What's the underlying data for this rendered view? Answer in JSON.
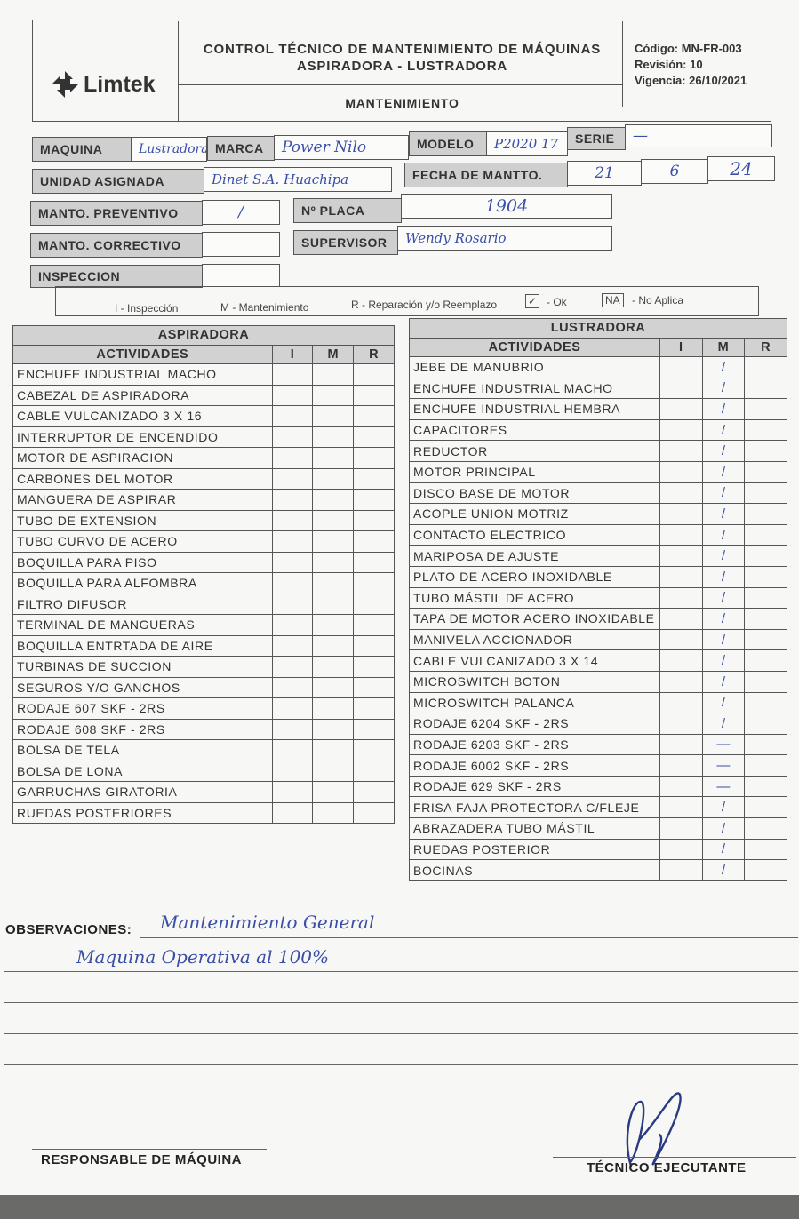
{
  "header": {
    "logo_text": "Limtek",
    "title_line1": "CONTROL TÉCNICO DE MANTENIMIENTO DE MÁQUINAS",
    "title_line2": "ASPIRADORA - LUSTRADORA",
    "subtitle": "MANTENIMIENTO",
    "codigo": "Código: MN-FR-003",
    "revision": "Revisión: 10",
    "vigencia": "Vigencia: 26/10/2021"
  },
  "fields": {
    "maquina_label": "MAQUINA",
    "maquina_value": "Lustradora",
    "marca_label": "MARCA",
    "marca_value": "Power Nilo",
    "modelo_label": "MODELO",
    "modelo_value": "P2020 17",
    "serie_label": "SERIE",
    "serie_value": "—",
    "unidad_label": "UNIDAD ASIGNADA",
    "unidad_value": "Dinet S.A. Huachipa",
    "fecha_label": "FECHA DE MANTTO.",
    "fecha_dd": "21",
    "fecha_mm": "6",
    "fecha_yy": "24",
    "preventivo_label": "MANTO. PREVENTIVO",
    "preventivo_value": "/",
    "placa_label": "Nº PLACA",
    "placa_value": "1904",
    "correctivo_label": "MANTO. CORRECTIVO",
    "correctivo_value": "",
    "supervisor_label": "SUPERVISOR",
    "supervisor_value": "Wendy Rosario",
    "inspeccion_label": "INSPECCION",
    "inspeccion_value": ""
  },
  "legend": {
    "i": "I - Inspección",
    "m": "M - Mantenimiento",
    "r": "R - Reparación y/o Reemplazo",
    "ok_box": "✓",
    "ok": "- Ok",
    "na_box": "NA",
    "na": "- No Aplica"
  },
  "aspiradora": {
    "title": "ASPIRADORA",
    "col_act": "ACTIVIDADES",
    "col_i": "I",
    "col_m": "M",
    "col_r": "R",
    "rows": [
      "ENCHUFE INDUSTRIAL MACHO",
      "CABEZAL DE ASPIRADORA",
      "CABLE VULCANIZADO 3 X 16",
      "INTERRUPTOR DE ENCENDIDO",
      "MOTOR DE ASPIRACION",
      "CARBONES DEL MOTOR",
      "MANGUERA DE ASPIRAR",
      "TUBO DE EXTENSION",
      "TUBO CURVO DE ACERO",
      "BOQUILLA PARA PISO",
      "BOQUILLA PARA ALFOMBRA",
      "FILTRO DIFUSOR",
      "TERMINAL DE MANGUERAS",
      "BOQUILLA ENTRTADA DE AIRE",
      "TURBINAS DE SUCCION",
      "SEGUROS Y/O GANCHOS",
      "RODAJE 607 SKF - 2RS",
      "RODAJE 608 SKF - 2RS",
      "BOLSA DE TELA",
      "BOLSA DE LONA",
      "GARRUCHAS GIRATORIA",
      "RUEDAS POSTERIORES"
    ]
  },
  "lustradora": {
    "title": "LUSTRADORA",
    "col_act": "ACTIVIDADES",
    "col_i": "I",
    "col_m": "M",
    "col_r": "R",
    "rows": [
      {
        "act": "JEBE DE MANUBRIO",
        "m": "/"
      },
      {
        "act": "ENCHUFE INDUSTRIAL MACHO",
        "m": "/"
      },
      {
        "act": "ENCHUFE INDUSTRIAL HEMBRA",
        "m": "/"
      },
      {
        "act": "CAPACITORES",
        "m": "/"
      },
      {
        "act": "REDUCTOR",
        "m": "/"
      },
      {
        "act": "MOTOR PRINCIPAL",
        "m": "/"
      },
      {
        "act": "DISCO BASE DE MOTOR",
        "m": "/"
      },
      {
        "act": "ACOPLE UNION MOTRIZ",
        "m": "/"
      },
      {
        "act": "CONTACTO ELECTRICO",
        "m": "/"
      },
      {
        "act": "MARIPOSA DE AJUSTE",
        "m": "/"
      },
      {
        "act": "PLATO DE ACERO INOXIDABLE",
        "m": "/"
      },
      {
        "act": "TUBO MÁSTIL DE ACERO",
        "m": "/"
      },
      {
        "act": "TAPA DE MOTOR ACERO INOXIDABLE",
        "m": "/"
      },
      {
        "act": "MANIVELA ACCIONADOR",
        "m": "/"
      },
      {
        "act": "CABLE VULCANIZADO 3 X 14",
        "m": "/"
      },
      {
        "act": "MICROSWITCH BOTON",
        "m": "/"
      },
      {
        "act": "MICROSWITCH PALANCA",
        "m": "/"
      },
      {
        "act": "RODAJE 6204 SKF - 2RS",
        "m": "/"
      },
      {
        "act": "RODAJE 6203 SKF - 2RS",
        "m": "—"
      },
      {
        "act": "RODAJE 6002 SKF - 2RS",
        "m": "—"
      },
      {
        "act": "RODAJE 629 SKF - 2RS",
        "m": "—"
      },
      {
        "act": "FRISA FAJA PROTECTORA C/FLEJE",
        "m": "/"
      },
      {
        "act": "ABRAZADERA TUBO MÁSTIL",
        "m": "/"
      },
      {
        "act": "RUEDAS POSTERIOR",
        "m": "/"
      },
      {
        "act": "BOCINAS",
        "m": "/"
      }
    ]
  },
  "observaciones": {
    "label": "OBSERVACIONES:",
    "line1": "Mantenimiento General",
    "line2": "Maquina Operativa al 100%"
  },
  "signatures": {
    "responsable": "RESPONSABLE DE MÁQUINA",
    "tecnico": "TÉCNICO EJECUTANTE"
  }
}
